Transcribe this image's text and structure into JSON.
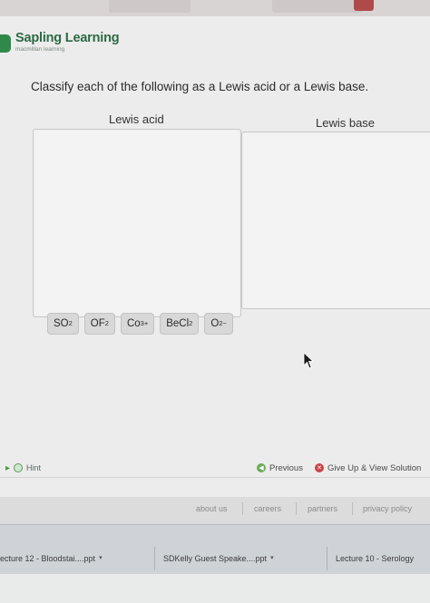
{
  "brand": {
    "title": "Sapling Learning",
    "subtitle": "macmillan learning"
  },
  "question": {
    "prompt": "Classify each of the following as a Lewis acid or a Lewis base."
  },
  "columns": {
    "acid_title": "Lewis acid",
    "base_title": "Lewis base"
  },
  "chips": [
    {
      "base": "SO",
      "sub": "2",
      "sup": ""
    },
    {
      "base": "OF",
      "sub": "2",
      "sup": ""
    },
    {
      "base": "Co",
      "sub": "",
      "sup": "3+"
    },
    {
      "base": "BeCl",
      "sub": "2",
      "sup": ""
    },
    {
      "base": "O",
      "sub": "",
      "sup": "2−"
    }
  ],
  "controls": {
    "hint_label": "Hint",
    "previous_label": "Previous",
    "giveup_label": "Give Up & View Solution"
  },
  "footer": {
    "links": [
      "about us",
      "careers",
      "partners",
      "privacy policy"
    ]
  },
  "taskbar": {
    "items": [
      "ecture 12 - Bloodstai....ppt",
      "SDKelly Guest Speake....ppt",
      "Lecture 10 - Serology"
    ]
  },
  "icons": {
    "logo": "sapling-logo-icon",
    "cursor": "mouse-pointer-icon",
    "hint": "lightbulb-icon",
    "previous": "previous-icon",
    "giveup": "giveup-icon"
  },
  "colors": {
    "brand": "#2c6a44",
    "previous": "#6cab5a",
    "giveup": "#c64545"
  }
}
